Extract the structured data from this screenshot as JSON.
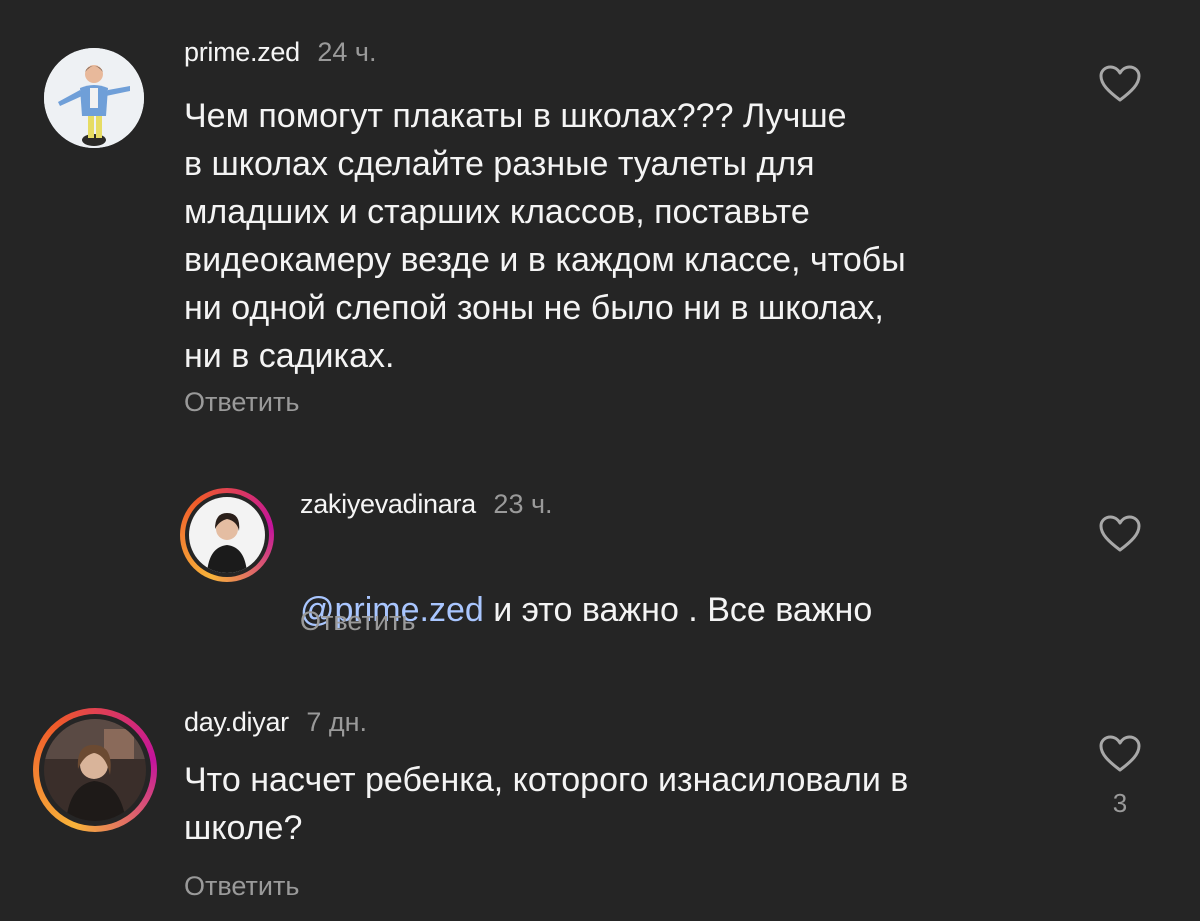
{
  "comments": [
    {
      "username": "prime.zed",
      "time": "24 ч.",
      "text": "Чем помогут плакаты в школах??? Лучше\nв школах сделайте разные туалеты для\nмладших и старших классов, поставьте\nвидеокамеру везде и в каждом классе, чтобы\nни одной слепой зоны не было ни в школах,\nни в садиках.",
      "reply_label": "Ответить"
    },
    {
      "username": "zakiyevadinara",
      "time": "23 ч.",
      "mention": "@prime.zed",
      "text": " и это важно . Все важно",
      "reply_label": "Ответить"
    },
    {
      "username": "day.diyar",
      "time": "7 дн.",
      "text": "Что насчет ребенка, которого изнасиловали в\nшколе?",
      "reply_label": "Ответить",
      "like_count": "3"
    }
  ],
  "icons": {
    "like": "heart-outline-icon"
  },
  "colors": {
    "background": "#252525",
    "text": "#f4f4f4",
    "muted": "#9a9a9a",
    "mention": "#a9c6ff",
    "story_ring_start": "#f8b33a",
    "story_ring_end": "#c3139d"
  }
}
